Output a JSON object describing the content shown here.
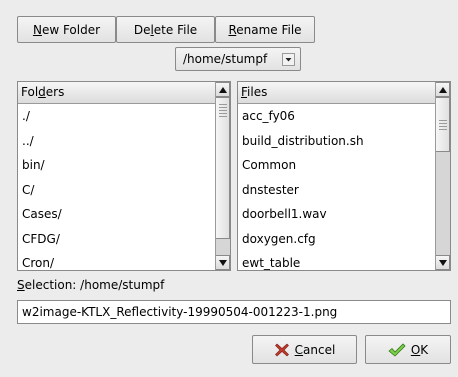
{
  "toolbar": {
    "new_folder": {
      "pre": "",
      "key": "N",
      "post": "ew Folder"
    },
    "delete_file": {
      "pre": "De",
      "key": "l",
      "post": "ete File"
    },
    "rename_file": {
      "pre": "",
      "key": "R",
      "post": "ename File"
    }
  },
  "path_combo": {
    "value": "/home/stumpf",
    "icon": "chevron-down-icon"
  },
  "folders": {
    "header": {
      "pre": "Fol",
      "key": "d",
      "post": "ers"
    },
    "items": [
      "./",
      "../",
      "bin/",
      "C/",
      "Cases/",
      "CFDG/",
      "Cron/"
    ]
  },
  "files": {
    "header": {
      "pre": "",
      "key": "F",
      "post": "iles"
    },
    "items": [
      "acc_fy06",
      "build_distribution.sh",
      "Common",
      "dnstester",
      "doorbell1.wav",
      "doxygen.cfg",
      "ewt_table"
    ]
  },
  "selection": {
    "label": {
      "pre": "",
      "key": "S",
      "post": "election: /home/stumpf"
    },
    "value": "w2image-KTLX_Reflectivity-19990504-001223-1.png"
  },
  "buttons": {
    "cancel": {
      "pre": "",
      "key": "C",
      "post": "ancel",
      "icon": "cancel-x-icon",
      "icon_color": "#c0392b"
    },
    "ok": {
      "pre": "",
      "key": "O",
      "post": "K",
      "icon": "checkmark-icon",
      "icon_color": "#4caf30"
    }
  }
}
